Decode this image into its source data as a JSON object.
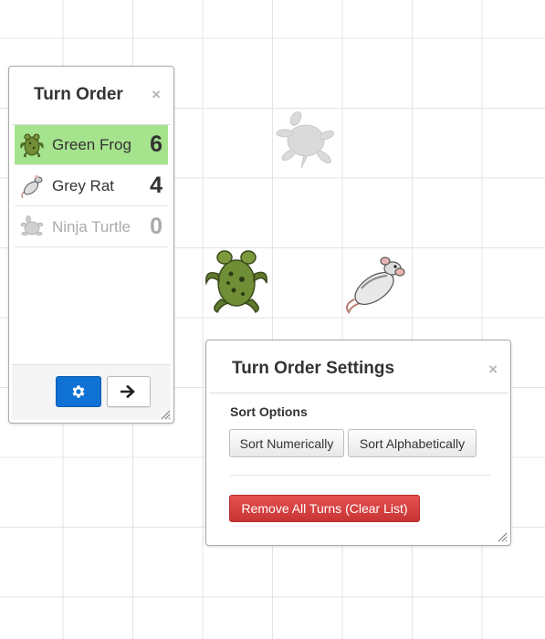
{
  "turn_order": {
    "title": "Turn Order",
    "close": "×",
    "entries": [
      {
        "name": "Green Frog",
        "value": "6",
        "icon": "frog-icon",
        "active": true
      },
      {
        "name": "Grey Rat",
        "value": "4",
        "icon": "rat-icon",
        "active": false
      },
      {
        "name": "Ninja Turtle",
        "value": "0",
        "icon": "turtle-icon",
        "active": false
      }
    ],
    "settings_icon": "gear-icon",
    "next_icon": "arrow-right-icon"
  },
  "settings": {
    "title": "Turn Order Settings",
    "close": "×",
    "sort_heading": "Sort Options",
    "sort_numerically": "Sort Numerically",
    "sort_alphabetically": "Sort Alphabetically",
    "clear_label": "Remove All Turns (Clear List)"
  },
  "colors": {
    "active_row": "#a5e38d",
    "primary_button": "#0f72d4",
    "danger_button": "#d94040"
  }
}
